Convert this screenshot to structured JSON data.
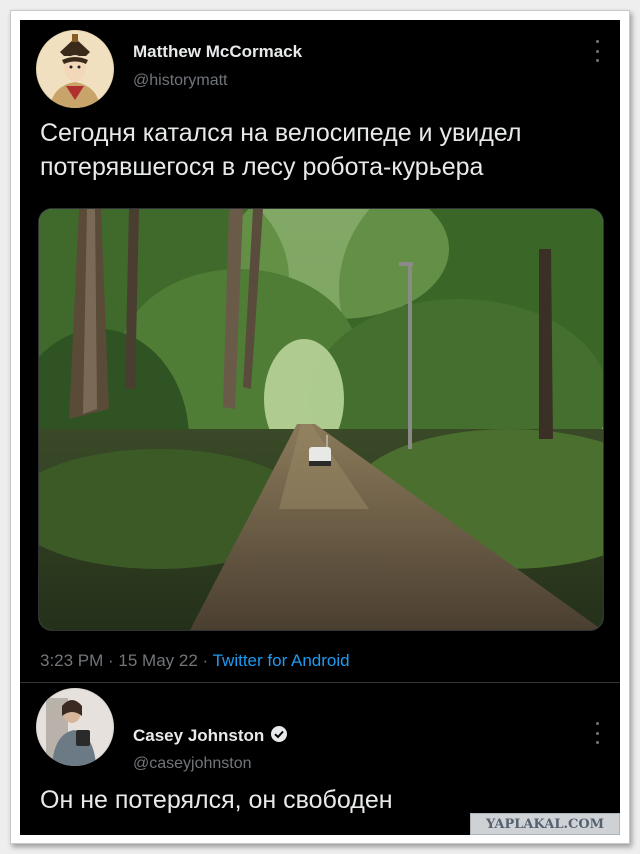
{
  "tweet": {
    "author_name": "Matthew McCormack",
    "author_handle": "@historymatt",
    "text": "Сегодня катался на велосипеде и увидел потерявшегося в лесу робота-курьера",
    "photo_icon": "forest-path-photo",
    "timestamp": "3:23 PM · 15 May 22 · ",
    "source": "Twitter for Android"
  },
  "reply": {
    "author_name": "Casey Johnston",
    "author_handle": "@caseyjohnston",
    "verified": true,
    "text": "Он не потерялся, он свободен"
  },
  "watermark": "YAPLAKAL.COM",
  "colors": {
    "background": "#000000",
    "text": "#e7e9ea",
    "muted": "#71767b",
    "link": "#1d9bf0"
  }
}
